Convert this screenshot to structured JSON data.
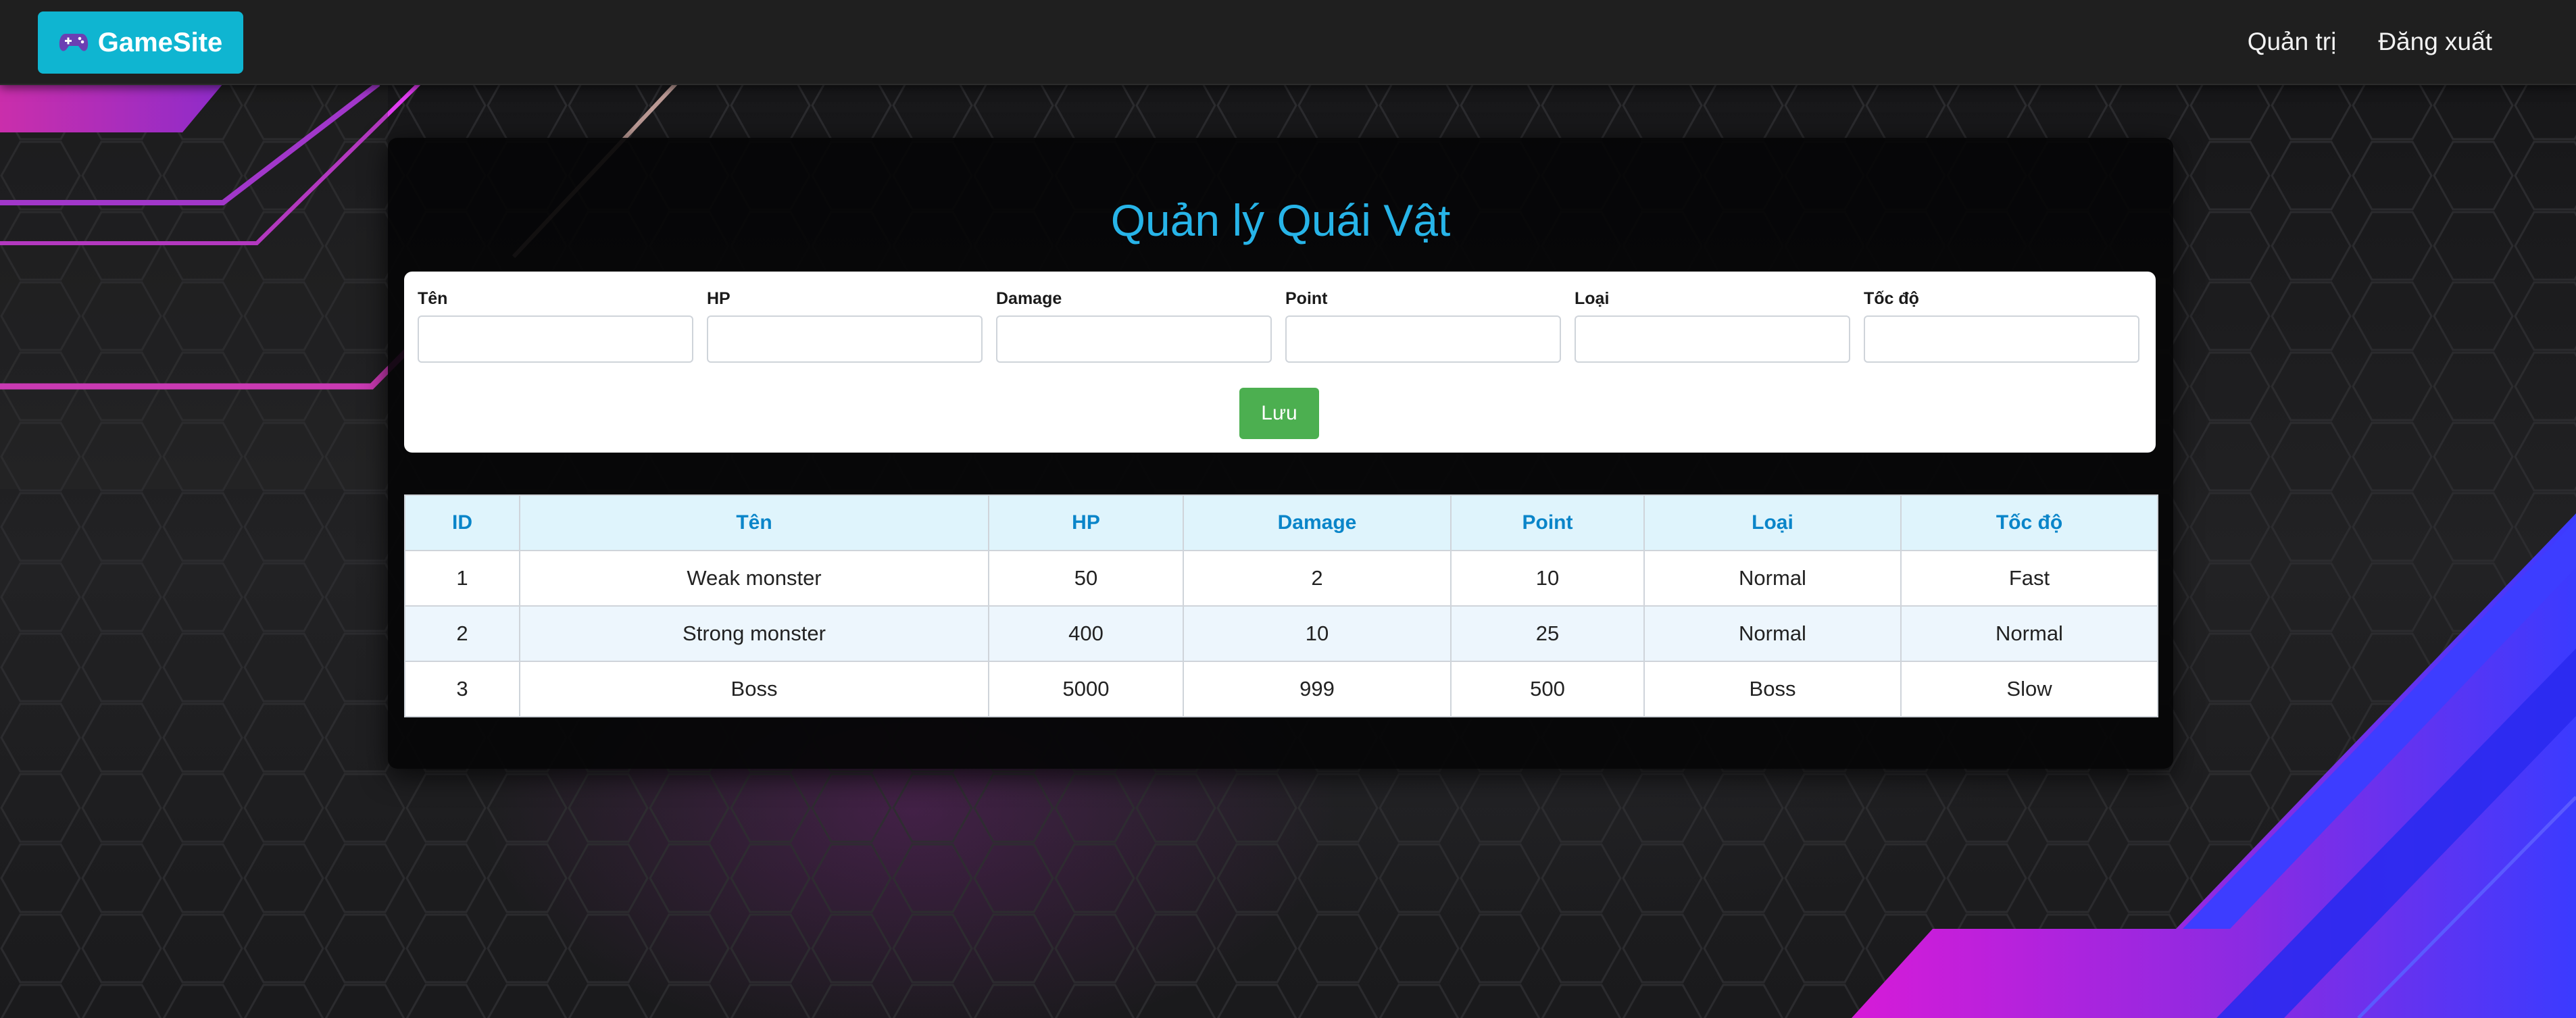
{
  "navbar": {
    "brand": "GameSite",
    "brand_icon": "gamepad-icon",
    "links": [
      "Quản trị",
      "Đăng xuất"
    ]
  },
  "page": {
    "title": "Quản lý Quái Vật"
  },
  "form": {
    "fields": [
      {
        "label": "Tên",
        "value": "",
        "placeholder": ""
      },
      {
        "label": "HP",
        "value": "",
        "placeholder": ""
      },
      {
        "label": "Damage",
        "value": "",
        "placeholder": ""
      },
      {
        "label": "Point",
        "value": "",
        "placeholder": ""
      },
      {
        "label": "Loại",
        "value": "",
        "placeholder": ""
      },
      {
        "label": "Tốc độ",
        "value": "",
        "placeholder": ""
      }
    ],
    "save_label": "Lưu",
    "save_color": "#4caf50"
  },
  "table": {
    "headers": [
      "ID",
      "Tên",
      "HP",
      "Damage",
      "Point",
      "Loại",
      "Tốc độ"
    ],
    "rows": [
      [
        "1",
        "Weak monster",
        "50",
        "2",
        "10",
        "Normal",
        "Fast"
      ],
      [
        "2",
        "Strong monster",
        "400",
        "10",
        "25",
        "Normal",
        "Normal"
      ],
      [
        "3",
        "Boss",
        "5000",
        "999",
        "500",
        "Boss",
        "Slow"
      ]
    ]
  },
  "colors": {
    "brand": "#0fb5d1",
    "title": "#27b4e8",
    "header_text": "#0a85c9",
    "header_bg": "#dff4fc"
  }
}
